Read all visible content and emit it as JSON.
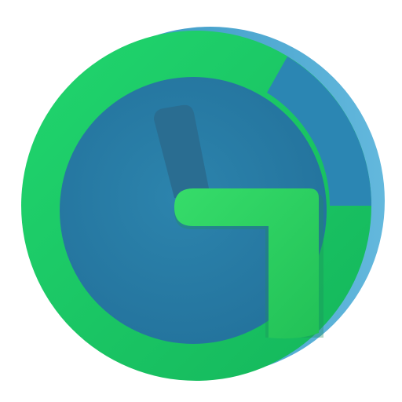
{
  "icon": {
    "name": "clock-app-icon",
    "colors": {
      "background": "#ffffff",
      "ring_green": "#1fd46a",
      "ring_green_dark": "#16b45a",
      "ring_blue_edge": "#4aa6cf",
      "face_teal": "#2a7fa8",
      "face_teal_dark": "#216f95",
      "hour_hand": "#2a6f93",
      "minute_hand_green": "#2ecf5f",
      "side_depth": "#3e9fcb"
    }
  }
}
